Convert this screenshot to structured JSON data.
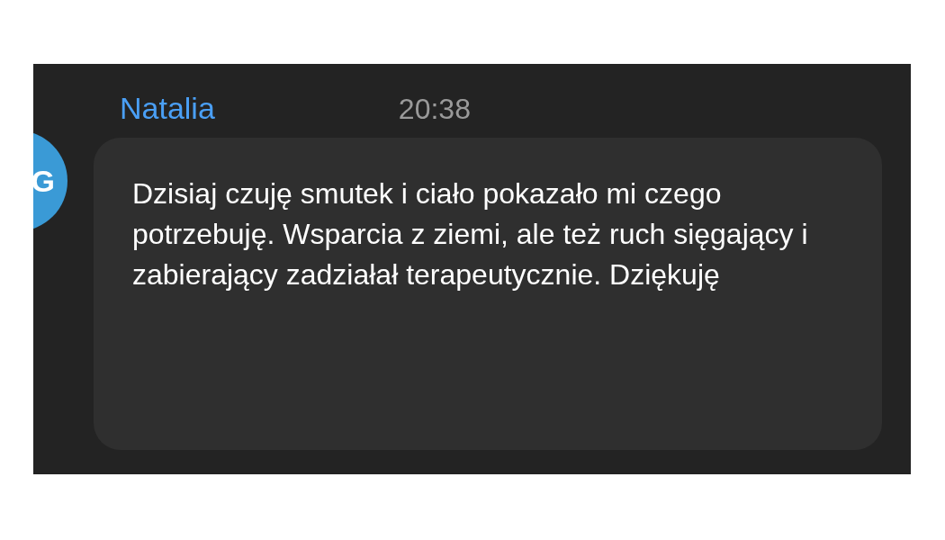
{
  "message": {
    "sender": "Natalia",
    "time": "20:38",
    "avatar_initial": "G",
    "text": "Dzisiaj czuję smutek i ciało pokazało mi czego potrzebuję. Wsparcia z ziemi, ale też ruch sięgający i zabierający zadziałał terapeutycznie. Dziękuję"
  }
}
